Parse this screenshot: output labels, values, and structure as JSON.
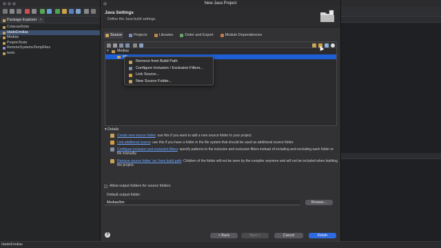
{
  "ide": {
    "package_explorer": {
      "tab_label": "Package Explorer",
      "items": [
        {
          "label": "CotacaoDolar",
          "selected": false
        },
        {
          "label": "IdadeEmdias",
          "selected": true
        },
        {
          "label": "Medias",
          "selected": false
        },
        {
          "label": "ProjetoTeste",
          "selected": false
        },
        {
          "label": "RemoteSystemsTempFiles",
          "selected": false
        },
        {
          "label": "teste",
          "selected": false
        }
      ]
    },
    "status_bar": "IdadeEmdias"
  },
  "dialog": {
    "window_title": "New Java Project",
    "header_title": "Java Settings",
    "header_subtitle": "Define the Java build settings.",
    "tabs": [
      {
        "label": "Source",
        "active": true
      },
      {
        "label": "Projects",
        "active": false
      },
      {
        "label": "Libraries",
        "active": false
      },
      {
        "label": "Order and Export",
        "active": false
      },
      {
        "label": "Module Dependencies",
        "active": false
      }
    ],
    "tree": {
      "root": "Medias",
      "child": "src"
    },
    "context_menu": [
      "Remove from Build Path",
      "Configure Inclusion / Exclusion Filters...",
      "Link Source...",
      "New Source Folder..."
    ],
    "details": {
      "heading": "Details",
      "rows": [
        {
          "link": "Create new source folder",
          "text": ": use this if you want to add a new source folder to your project."
        },
        {
          "link": "Link additional source",
          "text": ": use this if you have a folder in the file system that should be used as additional source folder."
        },
        {
          "link": "Configure inclusion and exclusion filters",
          "text": ": specify patterns to the inclusion and exclusion filters instead of including and excluding each folder or file manually."
        },
        {
          "link": "Remove source folder 'src' from build path",
          "text": ": Children of the folder will not be seen by the compiler anymore and will not be included when building the project."
        }
      ]
    },
    "allow_output_label": "Allow output folders for source folders",
    "default_output_label": "Default output folder:",
    "default_output_value": "Medias/bin",
    "browse_label": "Browse...",
    "buttons": {
      "back": "< Back",
      "next": "Next >",
      "cancel": "Cancel",
      "finish": "Finish",
      "help": "?"
    }
  },
  "colors": {
    "accent": "#2f6be0",
    "selection": "#1f5fd6",
    "link": "#6ea6ff"
  }
}
